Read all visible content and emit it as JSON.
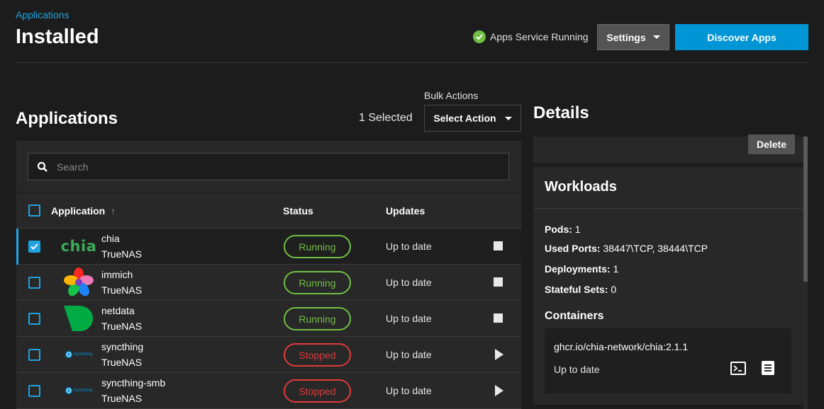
{
  "header": {
    "breadcrumb": "Applications",
    "title": "Installed",
    "service_status": "Apps Service Running",
    "service_status_color": "#71bf44",
    "settings_label": "Settings",
    "discover_label": "Discover Apps",
    "accent_color": "#0095d5"
  },
  "apps_panel": {
    "heading": "Applications",
    "selected_count": "1 Selected",
    "bulk_actions_label": "Bulk Actions",
    "select_action_label": "Select Action",
    "search_placeholder": "Search",
    "columns": {
      "application": "Application",
      "status": "Status",
      "updates": "Updates"
    },
    "rows": [
      {
        "name": "chia",
        "train": "TrueNAS",
        "status": "Running",
        "updates": "Up to date",
        "checked": true,
        "action_icon": "stop-icon",
        "logo": "chia-logo"
      },
      {
        "name": "immich",
        "train": "TrueNAS",
        "status": "Running",
        "updates": "Up to date",
        "checked": false,
        "action_icon": "stop-icon",
        "logo": "immich-logo"
      },
      {
        "name": "netdata",
        "train": "TrueNAS",
        "status": "Running",
        "updates": "Up to date",
        "checked": false,
        "action_icon": "stop-icon",
        "logo": "netdata-logo"
      },
      {
        "name": "syncthing",
        "train": "TrueNAS",
        "status": "Stopped",
        "updates": "Up to date",
        "checked": false,
        "action_icon": "play-icon",
        "logo": "syncthing-logo"
      },
      {
        "name": "syncthing-smb",
        "train": "TrueNAS",
        "status": "Stopped",
        "updates": "Up to date",
        "checked": false,
        "action_icon": "play-icon",
        "logo": "syncthing-logo"
      }
    ],
    "chia_logo_text": "chia",
    "syncthing_logo_text": "Syncthing"
  },
  "details": {
    "heading": "Details",
    "delete_label": "Delete",
    "workloads": {
      "title": "Workloads",
      "pods_label": "Pods:",
      "pods_value": "1",
      "ports_label": "Used Ports:",
      "ports_value": "38447\\TCP, 38444\\TCP",
      "deployments_label": "Deployments:",
      "deployments_value": "1",
      "stateful_label": "Stateful Sets:",
      "stateful_value": "0",
      "containers_title": "Containers",
      "container_image": "ghcr.io/chia-network/chia:2.1.1",
      "container_status": "Up to date"
    }
  }
}
